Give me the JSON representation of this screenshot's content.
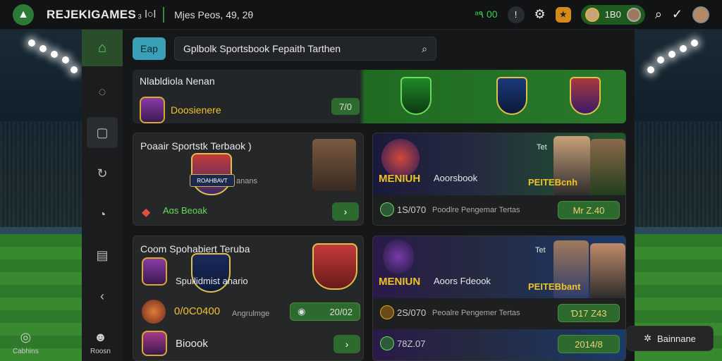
{
  "header": {
    "brand": "REJEKIGAMES",
    "brand_sub": "₃ l○l",
    "info": "Mjes Peos, 49, 2θ",
    "balance": "ᵃ٩ 00",
    "help_icon": "info-icon",
    "player_score": "1B0"
  },
  "sidebar": {
    "bottom_label": "Cabhins",
    "bottom_label_2": "Roosn"
  },
  "search": {
    "chip": "Eap",
    "placeholder": "Gplbolk Sportsbook Fepaith Tarthen"
  },
  "banner": {
    "title": "Nlabldiola Nenan",
    "label": "Doosienere",
    "button": "7/0"
  },
  "card1": {
    "title": "Poaair Sportstk Terbaok )",
    "sub": "anans",
    "bottom": "Aɑs Beoak",
    "plate": "ROAHBAVT"
  },
  "card2": {
    "label_left": "MENIUH",
    "label_mid": "Aoorsbook",
    "label_right": "Tet",
    "plate": "PEITEBcnh",
    "row_value": "1S/070",
    "row_text": "Poodlre Pengemar Tertas",
    "row_btn": "Mr Z.40"
  },
  "card3": {
    "title": "Coom Spohabiert Teruba",
    "mid": "Spuilidmist anario",
    "value": "0/0C0400",
    "sub": "Angrulmge",
    "score": "20/02",
    "bottom": "Bioook"
  },
  "card4": {
    "label_left": "MENIUN",
    "label_mid": "Aoors Fdeook",
    "label_right": "Tet",
    "plate": "PEITEBbant",
    "row_value": "2S/070",
    "row_text": "Peoalre Pengemer Tertas",
    "row_btn": "Ɗ17 Z43",
    "row2_value": "78Z.07",
    "row2_btn": "2014/8"
  },
  "floating": {
    "label": "Bainnane"
  }
}
